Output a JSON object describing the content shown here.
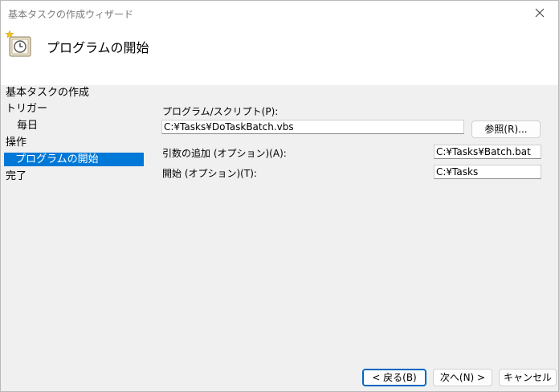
{
  "window": {
    "title": "基本タスクの作成ウィザード",
    "header_title": "プログラムの開始"
  },
  "steps": [
    {
      "label": "基本タスクの作成"
    },
    {
      "label": "トリガー"
    },
    {
      "label": "毎日"
    },
    {
      "label": "操作"
    },
    {
      "label": "プログラムの開始"
    },
    {
      "label": "完了"
    }
  ],
  "form": {
    "program_label": "プログラム/スクリプト(P):",
    "program_value": "C:¥Tasks¥DoTaskBatch.vbs",
    "browse_label": "参照(R)...",
    "args_label": "引数の追加 (オプション)(A):",
    "args_value": "C:¥Tasks¥Batch.bat",
    "start_label": "開始 (オプション)(T):",
    "start_value": "C:¥Tasks"
  },
  "buttons": {
    "back": "< 戻る(B)",
    "next": "次へ(N) >",
    "cancel": "キャンセル"
  },
  "colors": {
    "accent": "#0078d7",
    "content_bg": "#f0f0f0"
  }
}
